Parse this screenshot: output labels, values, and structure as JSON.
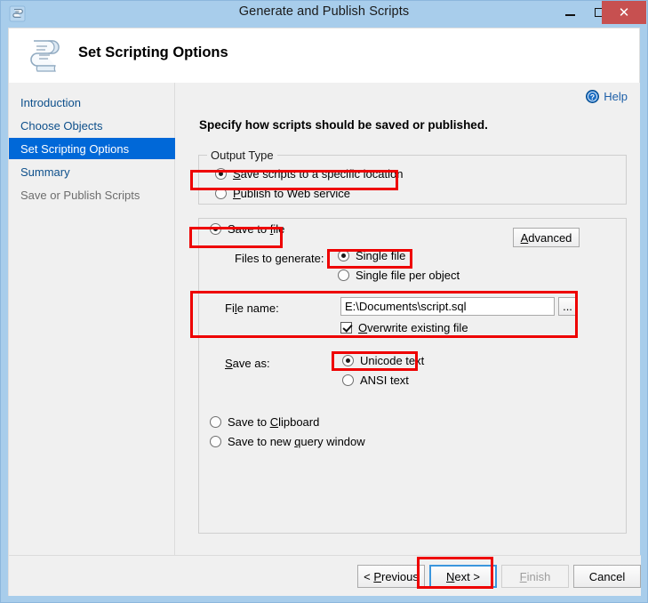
{
  "window": {
    "title": "Generate and Publish Scripts",
    "icon": "script-scroll-icon",
    "controls": {
      "minimize": "minimize-icon",
      "maximize": "maximize-icon",
      "close": "close-icon"
    },
    "colors": {
      "frame": "#a8cdeb",
      "close_button": "#c75050",
      "selection": "#0068d8",
      "annotation": "#ee0000",
      "link": "#1d5fa8"
    }
  },
  "header": {
    "title": "Set Scripting Options",
    "icon": "scroll-document-icon"
  },
  "sidebar": {
    "items": [
      {
        "label": "Introduction",
        "state": "normal"
      },
      {
        "label": "Choose Objects",
        "state": "normal"
      },
      {
        "label": "Set Scripting Options",
        "state": "selected"
      },
      {
        "label": "Summary",
        "state": "normal"
      },
      {
        "label": "Save or Publish Scripts",
        "state": "disabled"
      }
    ]
  },
  "content": {
    "help": {
      "label": "Help",
      "icon": "help-circle-icon"
    },
    "instruction": "Specify how scripts should be saved or published.",
    "output_type": {
      "legend": "Output Type",
      "options": [
        {
          "label": "Save scripts to a specific location",
          "accel": "S",
          "selected": true
        },
        {
          "label": "Publish to Web service",
          "accel": "P",
          "selected": false
        }
      ]
    },
    "save_group": {
      "save_to_file": {
        "label": "Save to file",
        "accel": "f",
        "selected": true
      },
      "advanced_button": {
        "label": "Advanced",
        "accel": "A"
      },
      "files_to_generate": {
        "label": "Files to generate:",
        "accel": "g",
        "options": [
          {
            "label": "Single file",
            "selected": true
          },
          {
            "label": "Single file per object",
            "selected": false
          }
        ]
      },
      "file_name": {
        "label": "File name:",
        "accel": "l",
        "value": "E:\\Documents\\script.sql",
        "browse_button": "..."
      },
      "overwrite": {
        "label": "Overwrite existing file",
        "accel": "O",
        "checked": true
      },
      "save_as": {
        "label": "Save as:",
        "accel": "S",
        "options": [
          {
            "label": "Unicode text",
            "selected": true
          },
          {
            "label": "ANSI text",
            "selected": false
          }
        ]
      },
      "save_to_clipboard": {
        "label": "Save to Clipboard",
        "accel": "C",
        "selected": false
      },
      "save_to_query_window": {
        "label": "Save to new query window",
        "accel": "q",
        "selected": false
      }
    }
  },
  "footer": {
    "buttons": [
      {
        "label": "< Previous",
        "accel": "P",
        "state": "normal"
      },
      {
        "label": "Next >",
        "accel": "N",
        "state": "focused"
      },
      {
        "label": "Finish",
        "accel": "F",
        "state": "disabled"
      },
      {
        "label": "Cancel",
        "accel": "",
        "state": "normal"
      }
    ]
  }
}
